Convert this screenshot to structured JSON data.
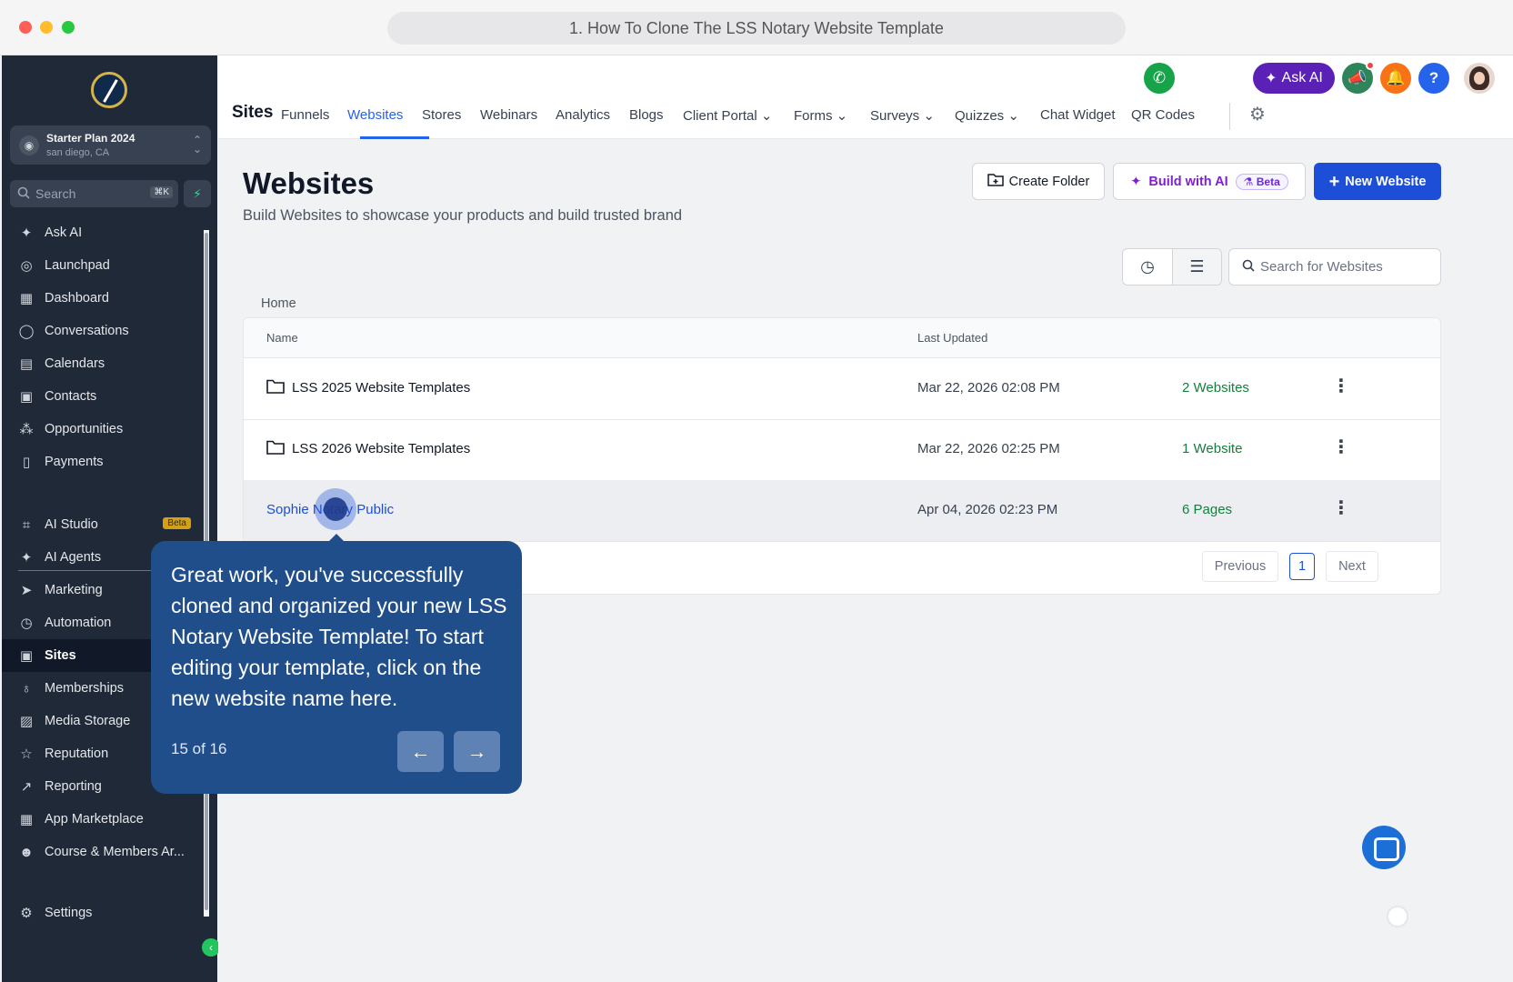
{
  "browser": {
    "url_title": "1. How To Clone The LSS Notary Website Template"
  },
  "sidebar": {
    "plan_name": "Starter Plan 2024",
    "plan_location": "san diego, CA",
    "search_placeholder": "Search",
    "search_shortcut": "⌘K",
    "items": [
      {
        "label": "Ask AI",
        "icon": "sparkle-icon"
      },
      {
        "label": "Launchpad",
        "icon": "rocket-icon"
      },
      {
        "label": "Dashboard",
        "icon": "grid-icon"
      },
      {
        "label": "Conversations",
        "icon": "chat-icon"
      },
      {
        "label": "Calendars",
        "icon": "calendar-icon"
      },
      {
        "label": "Contacts",
        "icon": "contacts-icon"
      },
      {
        "label": "Opportunities",
        "icon": "opportunities-icon"
      },
      {
        "label": "Payments",
        "icon": "receipt-icon"
      },
      {
        "label": "AI Studio",
        "icon": "ai-studio-icon",
        "badge": "Beta"
      },
      {
        "label": "AI Agents",
        "icon": "sparkle-icon"
      },
      {
        "label": "Marketing",
        "icon": "send-icon"
      },
      {
        "label": "Automation",
        "icon": "automation-icon"
      },
      {
        "label": "Sites",
        "icon": "sites-icon",
        "active": true
      },
      {
        "label": "Memberships",
        "icon": "award-icon"
      },
      {
        "label": "Media Storage",
        "icon": "image-icon"
      },
      {
        "label": "Reputation",
        "icon": "star-icon"
      },
      {
        "label": "Reporting",
        "icon": "trend-icon"
      },
      {
        "label": "App Marketplace",
        "icon": "apps-icon"
      },
      {
        "label": "Course & Members Ar...",
        "icon": "users-icon"
      }
    ],
    "settings_label": "Settings"
  },
  "topbar": {
    "ask_ai_label": "Ask AI",
    "help_label": "?",
    "section_title": "Sites",
    "tabs": [
      {
        "label": "Funnels"
      },
      {
        "label": "Websites",
        "active": true
      },
      {
        "label": "Stores"
      },
      {
        "label": "Webinars"
      },
      {
        "label": "Analytics"
      },
      {
        "label": "Blogs"
      },
      {
        "label": "Client Portal",
        "dropdown": true
      },
      {
        "label": "Forms",
        "dropdown": true
      },
      {
        "label": "Surveys",
        "dropdown": true
      },
      {
        "label": "Quizzes",
        "dropdown": true
      },
      {
        "label": "Chat Widget"
      },
      {
        "label": "QR Codes"
      }
    ]
  },
  "page": {
    "title": "Websites",
    "subtitle": "Build Websites to showcase your products and build trusted brand",
    "create_folder_label": "Create Folder",
    "build_ai_label": "Build with AI",
    "beta_label": "Beta",
    "new_website_label": "New Website",
    "search_placeholder": "Search for Websites",
    "breadcrumb": "Home"
  },
  "table": {
    "col_name": "Name",
    "col_updated": "Last Updated",
    "rows": [
      {
        "name": "LSS 2025 Website Templates",
        "type": "folder",
        "updated": "Mar 22, 2026 02:08 PM",
        "count": "2 Websites"
      },
      {
        "name": "LSS 2026 Website Templates",
        "type": "folder",
        "updated": "Mar 22, 2026 02:25 PM",
        "count": "1 Website"
      },
      {
        "name": "Sophie Notary Public",
        "type": "website",
        "updated": "Apr 04, 2026 02:23 PM",
        "count": "6 Pages"
      }
    ],
    "pager": {
      "previous": "Previous",
      "current": "1",
      "next": "Next"
    }
  },
  "tooltip": {
    "text": "Great work, you've successfully cloned and organized your new LSS Notary Website Template! To start editing your template, click on the new website name here.",
    "step": "15 of 16"
  },
  "colors": {
    "accent": "#2563eb",
    "sidebar_bg": "#1f2937",
    "tooltip_bg": "#1f4e8a",
    "success_text": "#15803d"
  }
}
